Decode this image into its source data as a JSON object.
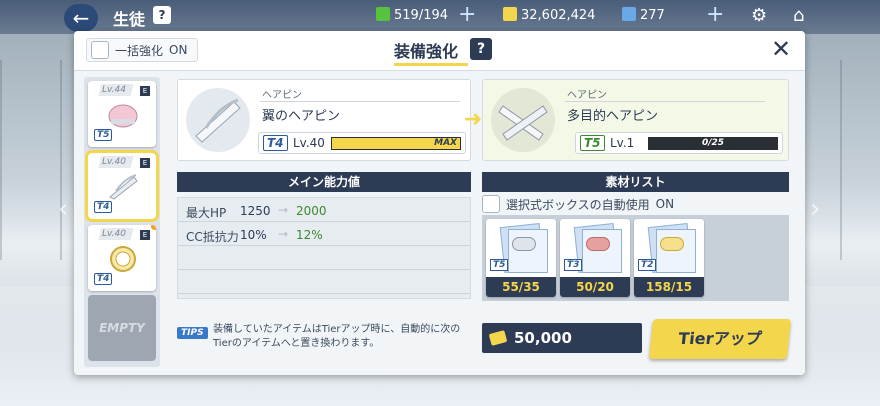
{
  "topbar": {
    "title": "生徒",
    "help": "?",
    "ap": "519/194",
    "credits": "32,602,424",
    "gems": "277"
  },
  "dialog": {
    "bulk_label": "一括強化",
    "bulk_state": "ON",
    "title": "装備強化",
    "help": "?",
    "close": "✕"
  },
  "item_list": [
    {
      "level": "Lv.44",
      "tier": "T5",
      "e": "E"
    },
    {
      "level": "Lv.40",
      "tier": "T4",
      "e": "E"
    },
    {
      "level": "Lv.40",
      "tier": "T4",
      "e": "E"
    }
  ],
  "empty_label": "EMPTY",
  "current": {
    "category": "ヘアピン",
    "name": "翼のヘアピン",
    "tier": "T4",
    "level": "Lv.40",
    "bar_label": "MAX",
    "progress": 1.0
  },
  "next": {
    "category": "ヘアピン",
    "name": "多目的ヘアピン",
    "tier": "T5",
    "level": "Lv.1",
    "bar_label": "0/25",
    "progress": 0.0
  },
  "sections": {
    "main": "メイン能力値",
    "materials": "素材リスト"
  },
  "stats": [
    {
      "label": "最大HP",
      "old": "1250",
      "new": "2000"
    },
    {
      "label": "CC抵抗力",
      "old": "10%",
      "new": "12%"
    }
  ],
  "auto_use": {
    "label": "選択式ボックスの自動使用",
    "state": "ON"
  },
  "materials": [
    {
      "tier": "T5",
      "count": "55/35"
    },
    {
      "tier": "T3",
      "count": "50/20"
    },
    {
      "tier": "T2",
      "count": "158/15"
    }
  ],
  "tips": {
    "tag": "TIPS",
    "text": "装備していたアイテムはTierアップ時に、自動的に次のTierのアイテムへと置き換わります。"
  },
  "cost": "50,000",
  "tier_up_button": "Tierアップ",
  "colors": {
    "navy": "#2d3b55",
    "accent_yellow": "#f4d64c",
    "green": "#3b8a2e"
  }
}
